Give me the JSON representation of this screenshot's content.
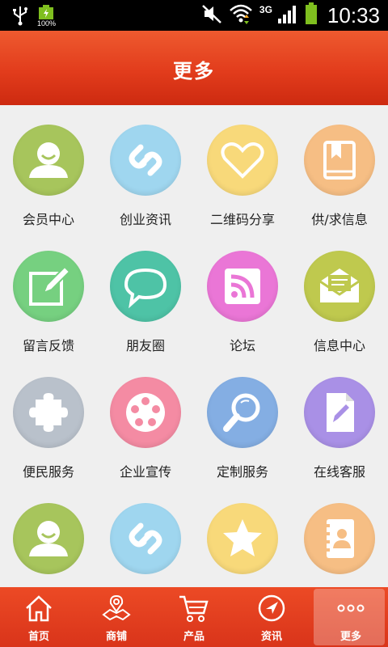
{
  "status_bar": {
    "battery_percent": "100%",
    "network": "3G",
    "time": "10:33"
  },
  "header": {
    "title": "更多"
  },
  "grid": {
    "items": [
      {
        "label": "会员中心",
        "icon": "user-icon",
        "color": "#a7c55c"
      },
      {
        "label": "创业资讯",
        "icon": "link-icon",
        "color": "#9fd6ef"
      },
      {
        "label": "二维码分享",
        "icon": "heart-icon",
        "color": "#f8d97a"
      },
      {
        "label": "供/求信息",
        "icon": "book-icon",
        "color": "#f6be84"
      },
      {
        "label": "留言反馈",
        "icon": "edit-icon",
        "color": "#76d080"
      },
      {
        "label": "朋友圈",
        "icon": "chat-bubble-icon",
        "color": "#4ec3a6"
      },
      {
        "label": "论坛",
        "icon": "rss-icon",
        "color": "#ea76d6"
      },
      {
        "label": "信息中心",
        "icon": "envelope-icon",
        "color": "#bfc94e"
      },
      {
        "label": "便民服务",
        "icon": "puzzle-icon",
        "color": "#b9c1cb"
      },
      {
        "label": "企业宣传",
        "icon": "film-reel-icon",
        "color": "#f48ba3"
      },
      {
        "label": "定制服务",
        "icon": "magnifier-icon",
        "color": "#84aee3"
      },
      {
        "label": "在线客服",
        "icon": "document-edit-icon",
        "color": "#a990e6"
      },
      {
        "label": "",
        "icon": "user-icon",
        "color": "#a7c55c"
      },
      {
        "label": "",
        "icon": "link-icon",
        "color": "#9fd6ef"
      },
      {
        "label": "",
        "icon": "star-icon",
        "color": "#f8d97a"
      },
      {
        "label": "",
        "icon": "contacts-book-icon",
        "color": "#f6be84"
      }
    ]
  },
  "tabbar": {
    "tabs": [
      {
        "label": "首页",
        "icon": "home-icon"
      },
      {
        "label": "商铺",
        "icon": "map-pin-icon"
      },
      {
        "label": "产品",
        "icon": "cart-icon"
      },
      {
        "label": "资讯",
        "icon": "compass-icon"
      },
      {
        "label": "更多",
        "icon": "more-dots-icon",
        "active": true
      }
    ]
  }
}
